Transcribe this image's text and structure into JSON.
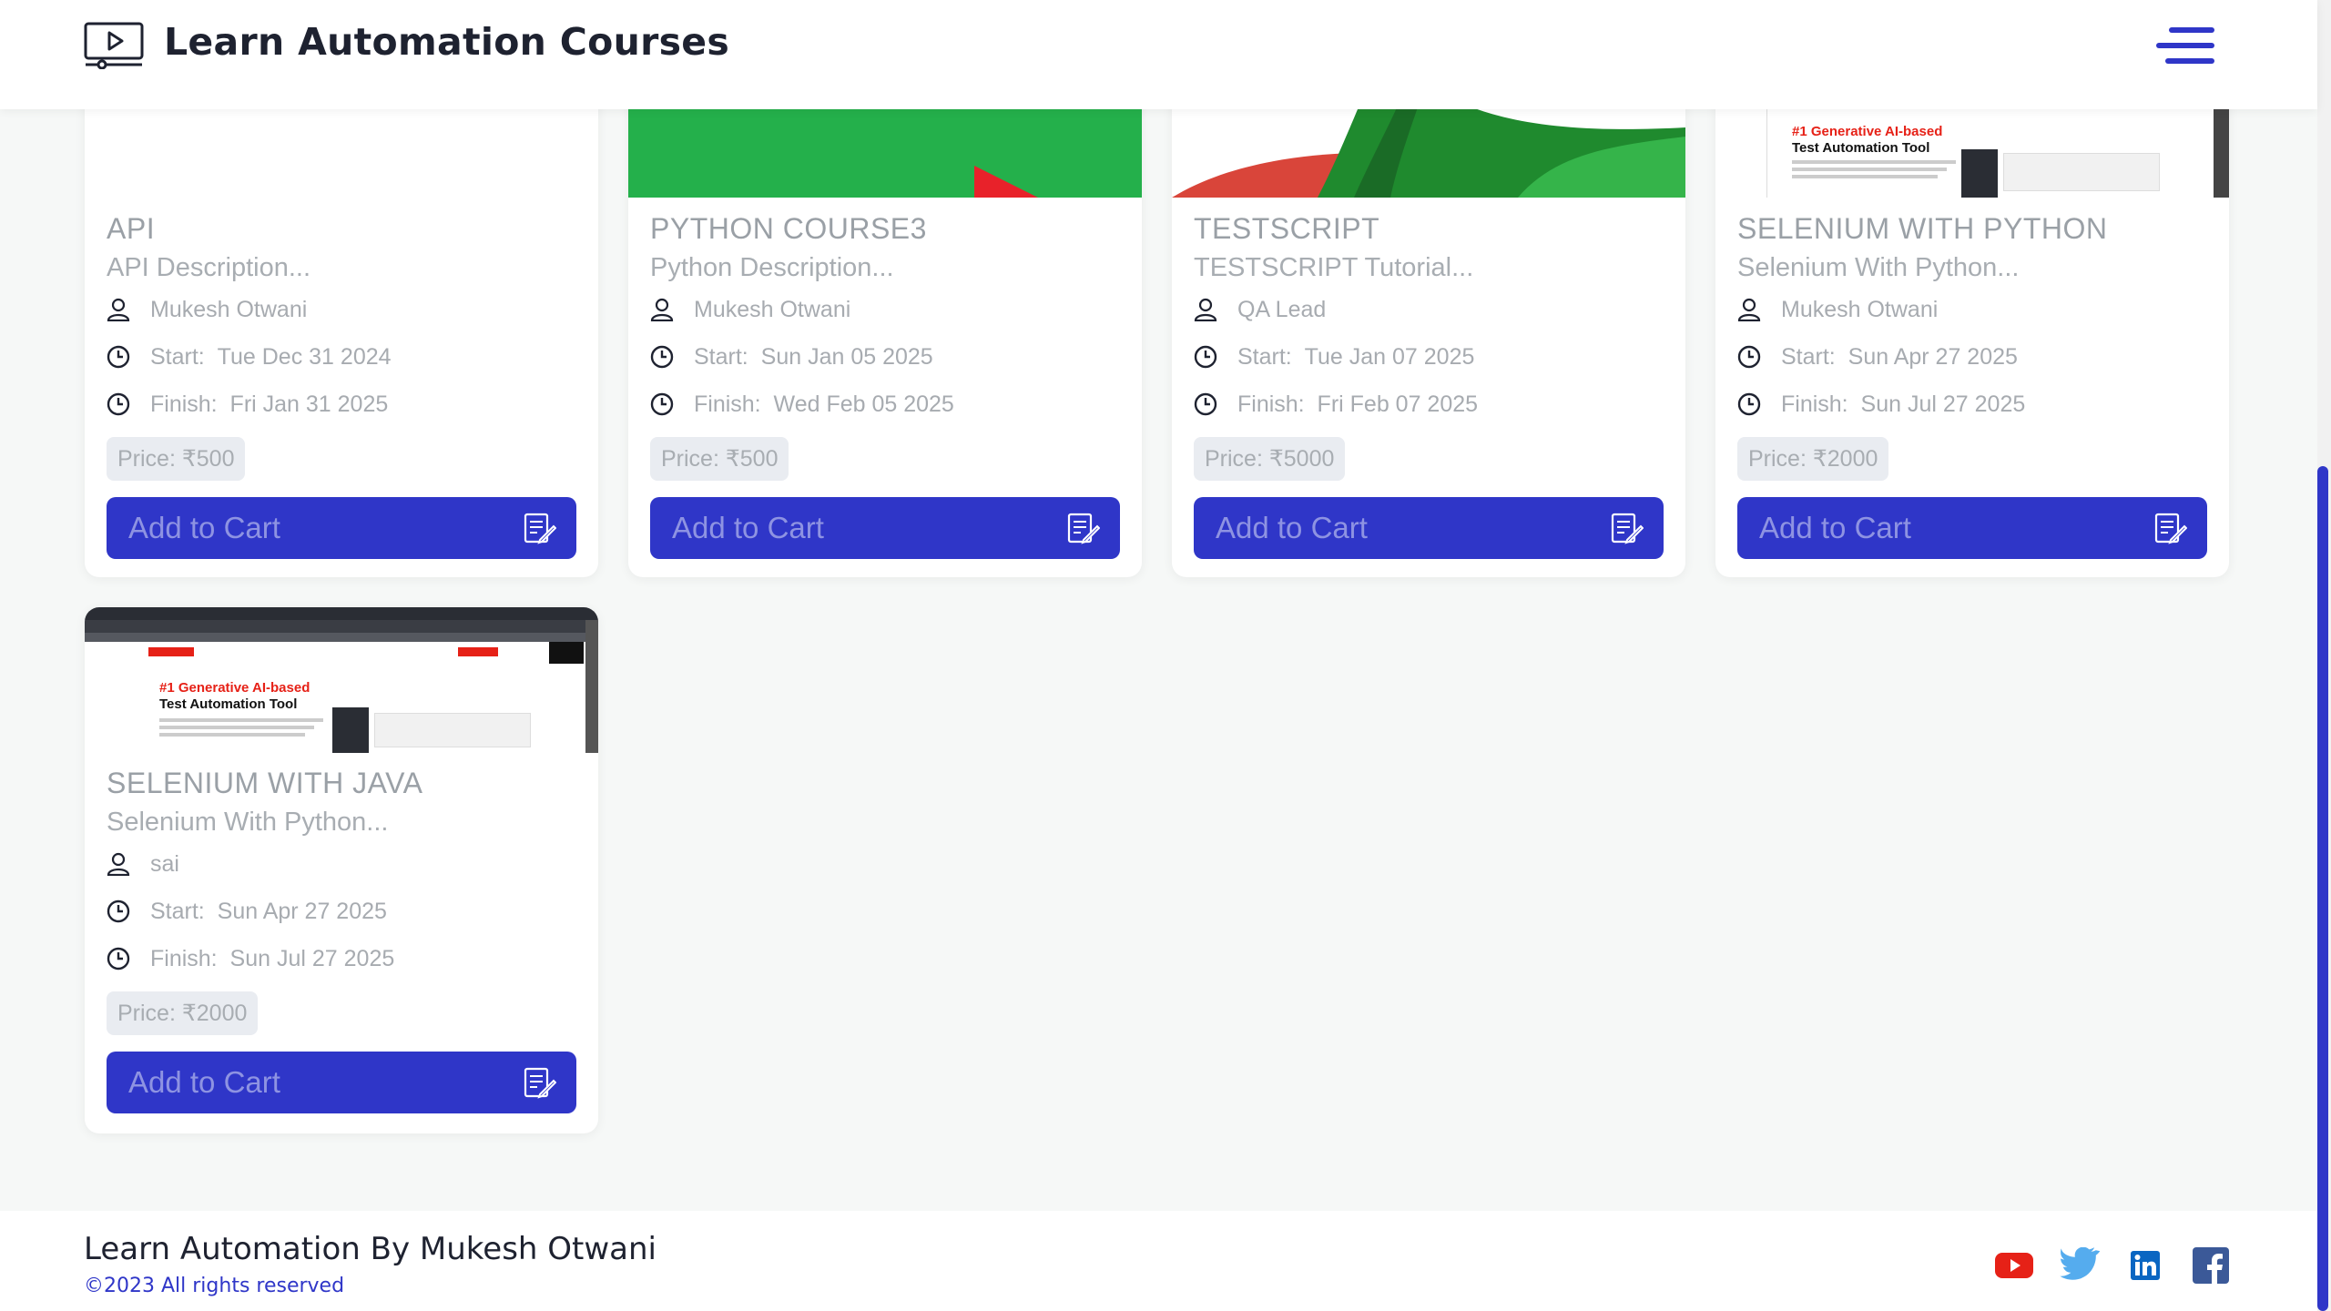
{
  "header": {
    "title": "Learn Automation Courses"
  },
  "labels": {
    "start": "Start:",
    "finish": "Finish:",
    "price_prefix": "Price: "
  },
  "courses": [
    {
      "title": "API",
      "description": "API Description...",
      "instructor": "Mukesh Otwani",
      "start": "Tue Dec 31 2024",
      "finish": "Fri Jan 31 2025",
      "price": "Price: ₹500",
      "button": "Add to Cart"
    },
    {
      "title": "PYTHON COURSE3",
      "description": "Python Description...",
      "instructor": "Mukesh Otwani",
      "start": "Sun Jan 05 2025",
      "finish": "Wed Feb 05 2025",
      "price": "Price: ₹500",
      "button": "Add to Cart"
    },
    {
      "title": "TESTSCRIPT",
      "description": "TESTSCRIPT Tutorial...",
      "instructor": "QA Lead",
      "start": "Tue Jan 07 2025",
      "finish": "Fri Feb 07 2025",
      "price": "Price: ₹5000",
      "button": "Add to Cart"
    },
    {
      "title": "SELENIUM WITH PYTHON",
      "description": "Selenium With Python...",
      "instructor": "Mukesh Otwani",
      "start": "Sun Apr 27 2025",
      "finish": "Sun Jul 27 2025",
      "price": "Price: ₹2000",
      "button": "Add to Cart"
    },
    {
      "title": "SELENIUM WITH JAVA",
      "description": "Selenium With Python...",
      "instructor": "sai",
      "start": "Sun Apr 27 2025",
      "finish": "Sun Jul 27 2025",
      "price": "Price: ₹2000",
      "button": "Add to Cart"
    }
  ],
  "thumbnail_text": {
    "headline_red": "#1 Generative AI-based",
    "headline_black": "Test Automation Tool"
  },
  "footer": {
    "title": "Learn Automation By Mukesh Otwani",
    "copyright": "©2023 All rights reserved"
  },
  "social": [
    "youtube-icon",
    "twitter-icon",
    "linkedin-icon",
    "facebook-icon"
  ],
  "colors": {
    "accent": "#2f36c8",
    "youtube": "#e62117",
    "twitter": "#55acee",
    "linkedin": "#0a66c2",
    "facebook": "#3b5998"
  }
}
